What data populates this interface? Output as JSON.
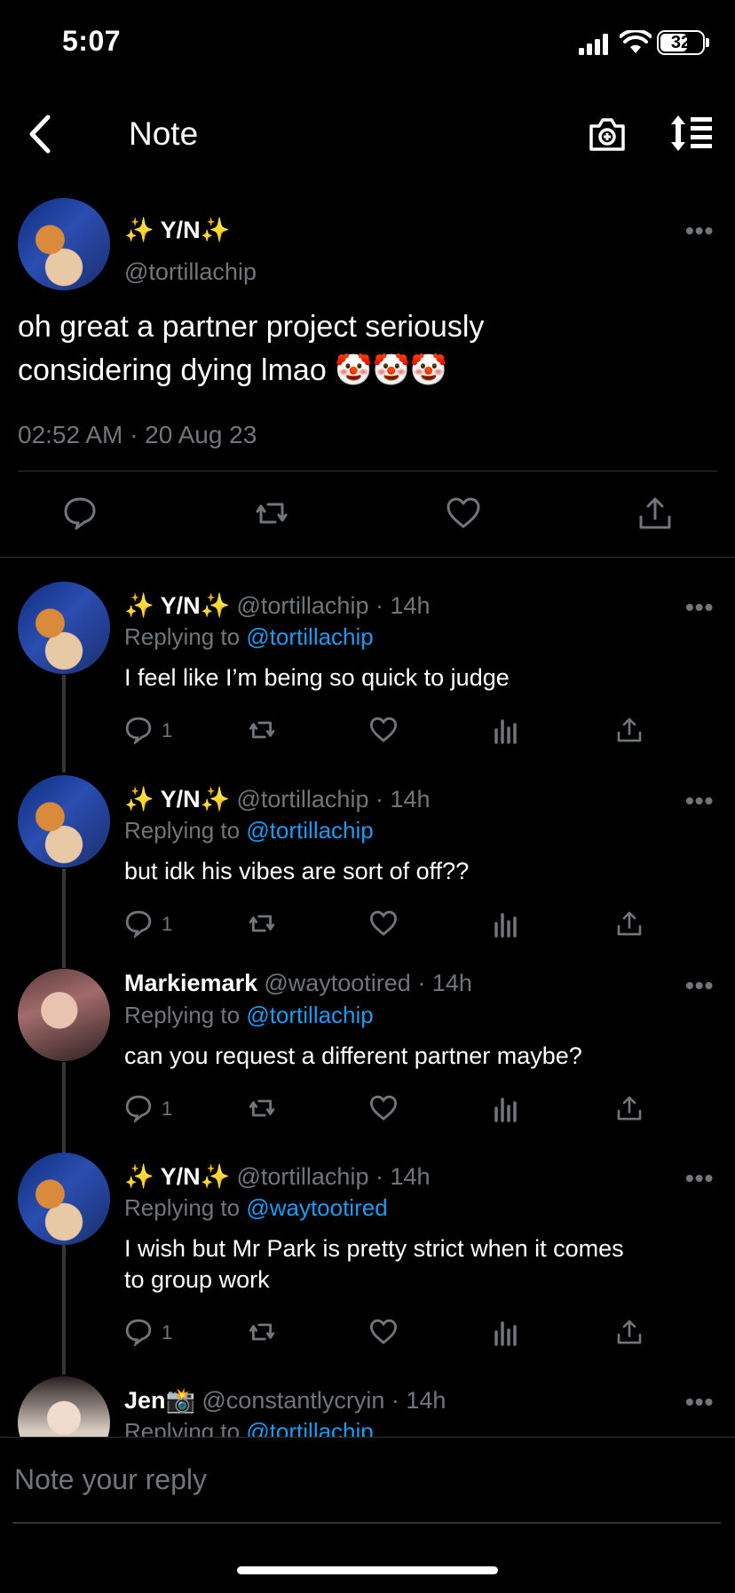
{
  "status_bar": {
    "time": "5:07",
    "battery": "32"
  },
  "header": {
    "title": "Note",
    "back_icon": "chevron-left-icon",
    "camera_icon": "camera-plus-icon",
    "sort_icon": "sort-icon"
  },
  "main_post": {
    "display_name": "✨ Y/N✨",
    "handle": "@tortillachip",
    "text_line1": "oh great a partner project seriously",
    "text_line2": "considering dying lmao 🤡🤡🤡",
    "timestamp": "02:52 AM · 20 Aug 23",
    "more": "•••"
  },
  "replies": [
    {
      "display_name": "✨ Y/N✨",
      "meta": "@tortillachip · 14h",
      "replying_prefix": "Replying to ",
      "replying_to": "@tortillachip",
      "text": "I feel like I’m being so quick to judge",
      "reply_count": "1",
      "more": "•••"
    },
    {
      "display_name": "✨ Y/N✨",
      "meta": "@tortillachip · 14h",
      "replying_prefix": "Replying to ",
      "replying_to": "@tortillachip",
      "text": "but idk his vibes are sort of off??",
      "reply_count": "1",
      "more": "•••"
    },
    {
      "display_name": "Markiemark",
      "meta": "@waytootired · 14h",
      "replying_prefix": "Replying to ",
      "replying_to": "@tortillachip",
      "text": "can you request a different partner maybe?",
      "reply_count": "1",
      "more": "•••"
    },
    {
      "display_name": "✨ Y/N✨",
      "meta": "@tortillachip · 14h",
      "replying_prefix": "Replying to ",
      "replying_to": "@waytootired",
      "text_line1": "I wish but Mr Park is pretty strict when it comes",
      "text_line2": "to group work",
      "reply_count": "1",
      "more": "•••"
    },
    {
      "display_name": "Jen📸",
      "meta": "@constantlycryin · 14h",
      "replying_prefix": "Replying to ",
      "replying_to": "@tortillachip",
      "more": "•••"
    }
  ],
  "composer": {
    "placeholder": "Note your reply"
  }
}
